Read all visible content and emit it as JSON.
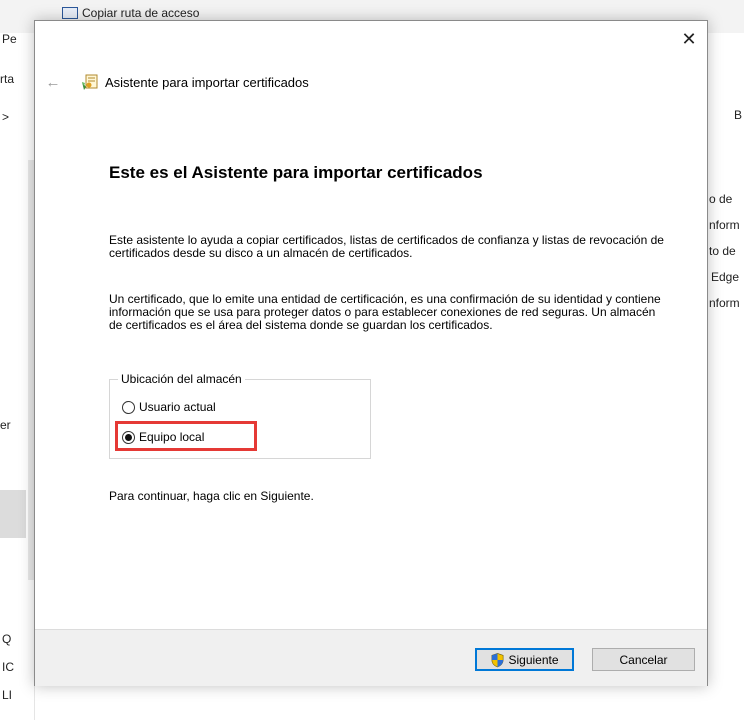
{
  "background": {
    "copy_path_label": "Copiar ruta de acceso",
    "left_fragments": [
      "Pe",
      "rta",
      ">",
      "er",
      "Q",
      "IC",
      "LI"
    ],
    "right_fragments": [
      "B",
      "o de",
      "nform",
      "to de",
      "Edge",
      "nform"
    ]
  },
  "dialog": {
    "title": "Asistente para importar certificados",
    "close_glyph": "✕",
    "back_glyph": "←",
    "heading": "Este es el Asistente para importar certificados",
    "paragraph1": "Este asistente lo ayuda a copiar certificados, listas de certificados de confianza y listas de revocación de certificados desde su disco a un almacén de certificados.",
    "paragraph2": "Un certificado, que lo emite una entidad de certificación, es una confirmación de su identidad y contiene información que se usa para proteger datos o para establecer conexiones de red seguras. Un almacén de certificados es el área del sistema donde se guardan los certificados.",
    "store_location": {
      "legend": "Ubicación del almacén",
      "options": [
        {
          "label": "Usuario actual",
          "selected": false
        },
        {
          "label": "Equipo local",
          "selected": true
        }
      ],
      "highlight_color": "#e53935"
    },
    "continue_text": "Para continuar, haga clic en Siguiente.",
    "buttons": {
      "next": "Siguiente",
      "cancel": "Cancelar"
    }
  },
  "icons": {
    "wizard": "certificate-wizard-icon",
    "uac_shield": "uac-shield-icon"
  },
  "colors": {
    "accent": "#0078d7",
    "highlight": "#e53935"
  }
}
